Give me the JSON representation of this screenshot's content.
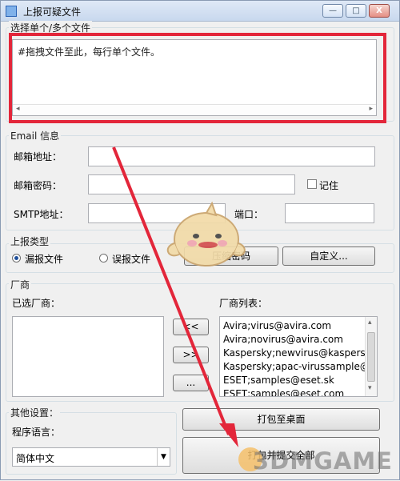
{
  "window": {
    "title": "上报可疑文件",
    "minimize_glyph": "—",
    "maximize_glyph": "□",
    "close_glyph": "X"
  },
  "file_select": {
    "legend": "选择单个/多个文件",
    "placeholder": "#拖拽文件至此，每行单个文件。"
  },
  "email": {
    "legend": "Email 信息",
    "mailbox_label": "邮箱地址：",
    "password_label": "邮箱密码：",
    "remember_label": "记住",
    "smtp_label": "SMTP地址：",
    "port_label": "端口："
  },
  "report_type": {
    "legend": "上报类型",
    "missed_label": "漏报文件",
    "false_label": "误报文件",
    "zip_password_button": "压缩密码",
    "custom_button": "自定义..."
  },
  "vendors": {
    "legend": "厂商",
    "selected_label": "已选厂商：",
    "list_label": "厂商列表：",
    "add_all_button": "<<",
    "remove_all_button": ">>",
    "more_button": "...",
    "items": [
      "Avira;virus@avira.com",
      "Avira;novirus@avira.com",
      "Kaspersky;newvirus@kaspersk",
      "Kaspersky;apac-virussample@",
      "ESET;samples@eset.sk",
      "ESET;samples@eset.com"
    ]
  },
  "other": {
    "legend": "其他设置：",
    "language_label": "程序语言：",
    "language_value": "简体中文",
    "pack_button": "打包至桌面",
    "submit_button": "打包并提交全部"
  },
  "watermark": {
    "text": "3DMGAME"
  },
  "colors": {
    "annotation_red": "#e3263a",
    "title_bar": "#c8d8ee"
  }
}
